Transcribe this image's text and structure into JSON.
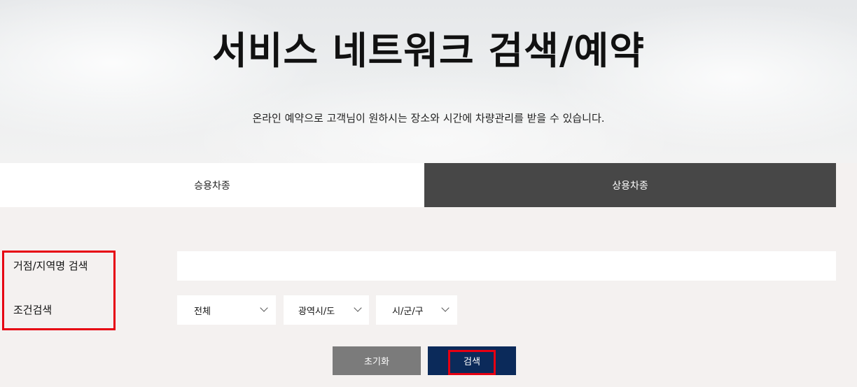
{
  "hero": {
    "title": "서비스 네트워크 검색/예약",
    "description": "온라인 예약으로 고객님이 원하시는 장소와 시간에 차량관리를 받을 수 있습니다."
  },
  "tabs": [
    {
      "label": "승용차종",
      "active": false
    },
    {
      "label": "상용차종",
      "active": true
    }
  ],
  "form": {
    "location_label": "거점/지역명 검색",
    "location_value": "",
    "location_placeholder": "",
    "condition_label": "조건검색",
    "selects": [
      {
        "value": "전체"
      },
      {
        "value": "광역시/도"
      },
      {
        "value": "시/군/구"
      }
    ]
  },
  "buttons": {
    "reset_label": "초기화",
    "search_label": "검색"
  },
  "colors": {
    "active_tab": "#474747",
    "search_button": "#0b2a5a",
    "reset_button": "#7b7b7b",
    "highlight": "#e60012"
  }
}
